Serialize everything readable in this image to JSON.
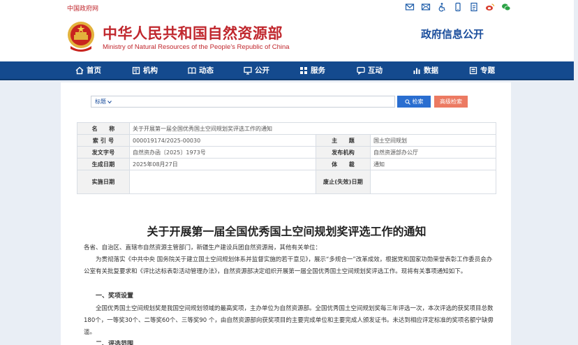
{
  "top": {
    "gov_link": "中国政府网",
    "icons": [
      "mail-icon",
      "mail-alt-icon",
      "accessibility-icon",
      "mobile-icon",
      "document-icon",
      "weibo-icon",
      "wechat-icon"
    ]
  },
  "header": {
    "title_cn": "中华人民共和国自然资源部",
    "title_en": "Ministry of Natural Resources of the People’s Republic of China",
    "section": "政府信息公开"
  },
  "nav": [
    {
      "label": "首页",
      "icon": "home-icon"
    },
    {
      "label": "机构",
      "icon": "book-icon"
    },
    {
      "label": "动态",
      "icon": "news-icon"
    },
    {
      "label": "公开",
      "icon": "monitor-icon"
    },
    {
      "label": "服务",
      "icon": "grid-icon"
    },
    {
      "label": "互动",
      "icon": "chat-icon"
    },
    {
      "label": "数据",
      "icon": "bar-chart-icon"
    },
    {
      "label": "专题",
      "icon": "topic-icon"
    }
  ],
  "search": {
    "select_value": "标题",
    "placeholder": "",
    "search_label": "检索",
    "advanced_label": "高级检索"
  },
  "meta": {
    "name_label": "名　　称",
    "name_value": "关于开展第一届全国优秀国土空间规划奖评选工作的通知",
    "index_label": "索 引 号",
    "index_value": "000019174/2025-00030",
    "topic_label": "主　　题",
    "topic_value": "国土空间规划",
    "doc_no_label": "发文字号",
    "doc_no_value": "自然资办函〔2025〕1973号",
    "issuer_label": "发布机构",
    "issuer_value": "自然资源部办公厅",
    "date_label": "生成日期",
    "date_value": "2025年08月27日",
    "genre_label": "体　　裁",
    "genre_value": "通知",
    "effective_label": "实施日期",
    "effective_value": "",
    "expiry_label": "废止(失效)日期",
    "expiry_value": ""
  },
  "article": {
    "title": "关于开展第一届全国优秀国土空间规划奖评选工作的通知",
    "salutation": "各省、自治区、直辖市自然资源主管部门，新疆生产建设兵团自然资源局，其他有关单位：",
    "intro": "为贯彻落实《中共中央 国务院关于建立国土空间规划体系并监督实施的若干意见》，展示“多规合一”改革成效，根据党和国家功勋荣誉表彰工作委员会办公室有关批复要求和《评比达标表彰活动管理办法》，自然资源部决定组织开展第一届全国优秀国土空间规划奖评选工作。现将有关事项通知如下。",
    "heading1": "一、奖项设置",
    "para1": "全国优秀国土空间规划奖是我国空间规划领域的最高奖项，主办单位为自然资源部。全国优秀国土空间规划奖每三年评选一次，本次评选的获奖项目总数180个，一等奖30个、二等奖60个、三等奖90 个，由自然资源部向获奖项目的主要完成单位和主要完成人颁发证书。未达到相应评定标准的奖项名额宁缺毋滥。",
    "heading2": "二、评选范围"
  }
}
